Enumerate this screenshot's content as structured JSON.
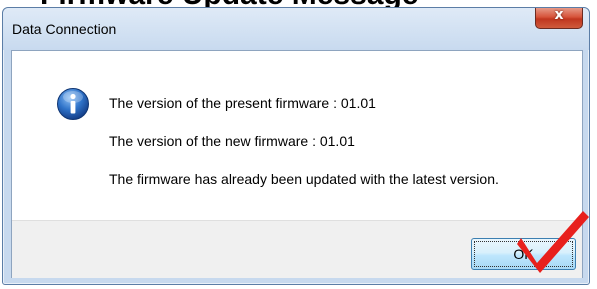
{
  "page_heading": "Firmware Update Message",
  "dialog": {
    "title": "Data Connection",
    "close_glyph": "x",
    "icon": "info-icon",
    "messages": {
      "present_version": "The version of the present firmware : 01.01",
      "new_version": "The version of the new firmware : 01.01",
      "status": "The firmware has already been updated with the latest version."
    },
    "ok_label": "OK"
  },
  "annotation": {
    "icon": "checkmark-icon",
    "color": "#e8201c"
  },
  "colors": {
    "titlebar": "#c8daef",
    "close_button": "#c0361f",
    "info_icon": "#1f5fb8",
    "ok_button_border": "#3c7fb1"
  }
}
